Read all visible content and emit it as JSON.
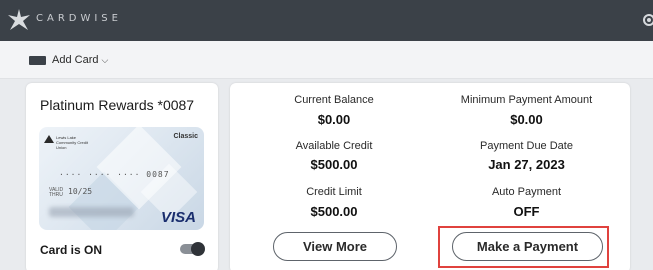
{
  "app": {
    "logo_text": "CARDWISE"
  },
  "subbar": {
    "add_card_label": "Add Card"
  },
  "card": {
    "title": "Platinum Rewards *0087",
    "bank_name": "Lewis Lake Community Credit Union",
    "tier": "Classic",
    "number_masked": "···· ···· ···· 0087",
    "valid_label": "VALID THRU",
    "expiry": "10/25",
    "network": "VISA",
    "status_label": "Card is ON",
    "toggle_on": true
  },
  "summary": {
    "current_balance_label": "Current Balance",
    "current_balance_value": "$0.00",
    "available_credit_label": "Available Credit",
    "available_credit_value": "$500.00",
    "credit_limit_label": "Credit Limit",
    "credit_limit_value": "$500.00",
    "min_payment_label": "Minimum Payment Amount",
    "min_payment_value": "$0.00",
    "due_date_label": "Payment Due Date",
    "due_date_value": "Jan 27, 2023",
    "auto_payment_label": "Auto Payment",
    "auto_payment_value": "OFF"
  },
  "actions": {
    "view_more_label": "View More",
    "make_payment_label": "Make a Payment"
  },
  "colors": {
    "topbar": "#3b4148",
    "highlight": "#e0423e",
    "visa": "#1a2e6e"
  },
  "icons": {
    "logo": "star-burst-logo-icon",
    "settings": "gear-icon",
    "card": "credit-card-icon",
    "chevron": "chevron-down-icon"
  }
}
